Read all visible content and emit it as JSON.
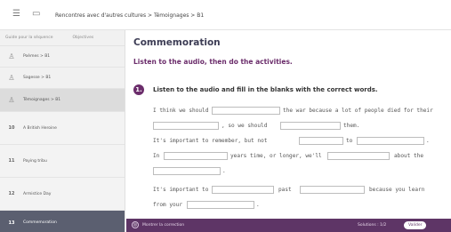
{
  "breadcrumb": "Rencontres avec d'autres cultures > Témoignages > B1",
  "sidebar": {
    "head_left": "Guide pour la séquence",
    "head_right": "Objectives",
    "items": [
      {
        "icon": "person-icon",
        "label": "Poèmes > B1"
      },
      {
        "icon": "person-icon",
        "label": "Sagesse > B1"
      },
      {
        "icon": "person-icon",
        "label": "Témoignages > B1"
      }
    ],
    "subitems": [
      {
        "num": "10",
        "label": "A British Heroine"
      },
      {
        "num": "11",
        "label": "Paying tribu"
      },
      {
        "num": "12",
        "label": "Armistice Day"
      },
      {
        "num": "13",
        "label": "Commemoration"
      }
    ]
  },
  "content": {
    "title": "Commemoration",
    "subtitle": "Listen to the audio, then do the activities.",
    "badge": "1.",
    "instruction": "Listen to the audio and fill in the blanks with the correct words.",
    "text": {
      "l1a": "I think we should",
      "l1b": "the war because a lot of people died for their",
      "l2a": ", so we should",
      "l2b": "them.",
      "l3a": "It's important to remember, but not",
      "l3b": "to",
      "l3c": ".",
      "l4a": "In",
      "l4b": "years time, or longer, we'll",
      "l4c": "about the",
      "l5a": ".",
      "l6a": "It's important to",
      "l6b": "past",
      "l6c": "because you learn",
      "l7a": "from your",
      "l7b": "."
    }
  },
  "bottombar": {
    "left": "Montrer la correction",
    "right": "Solutions : 1/2",
    "validate": "Valider"
  }
}
